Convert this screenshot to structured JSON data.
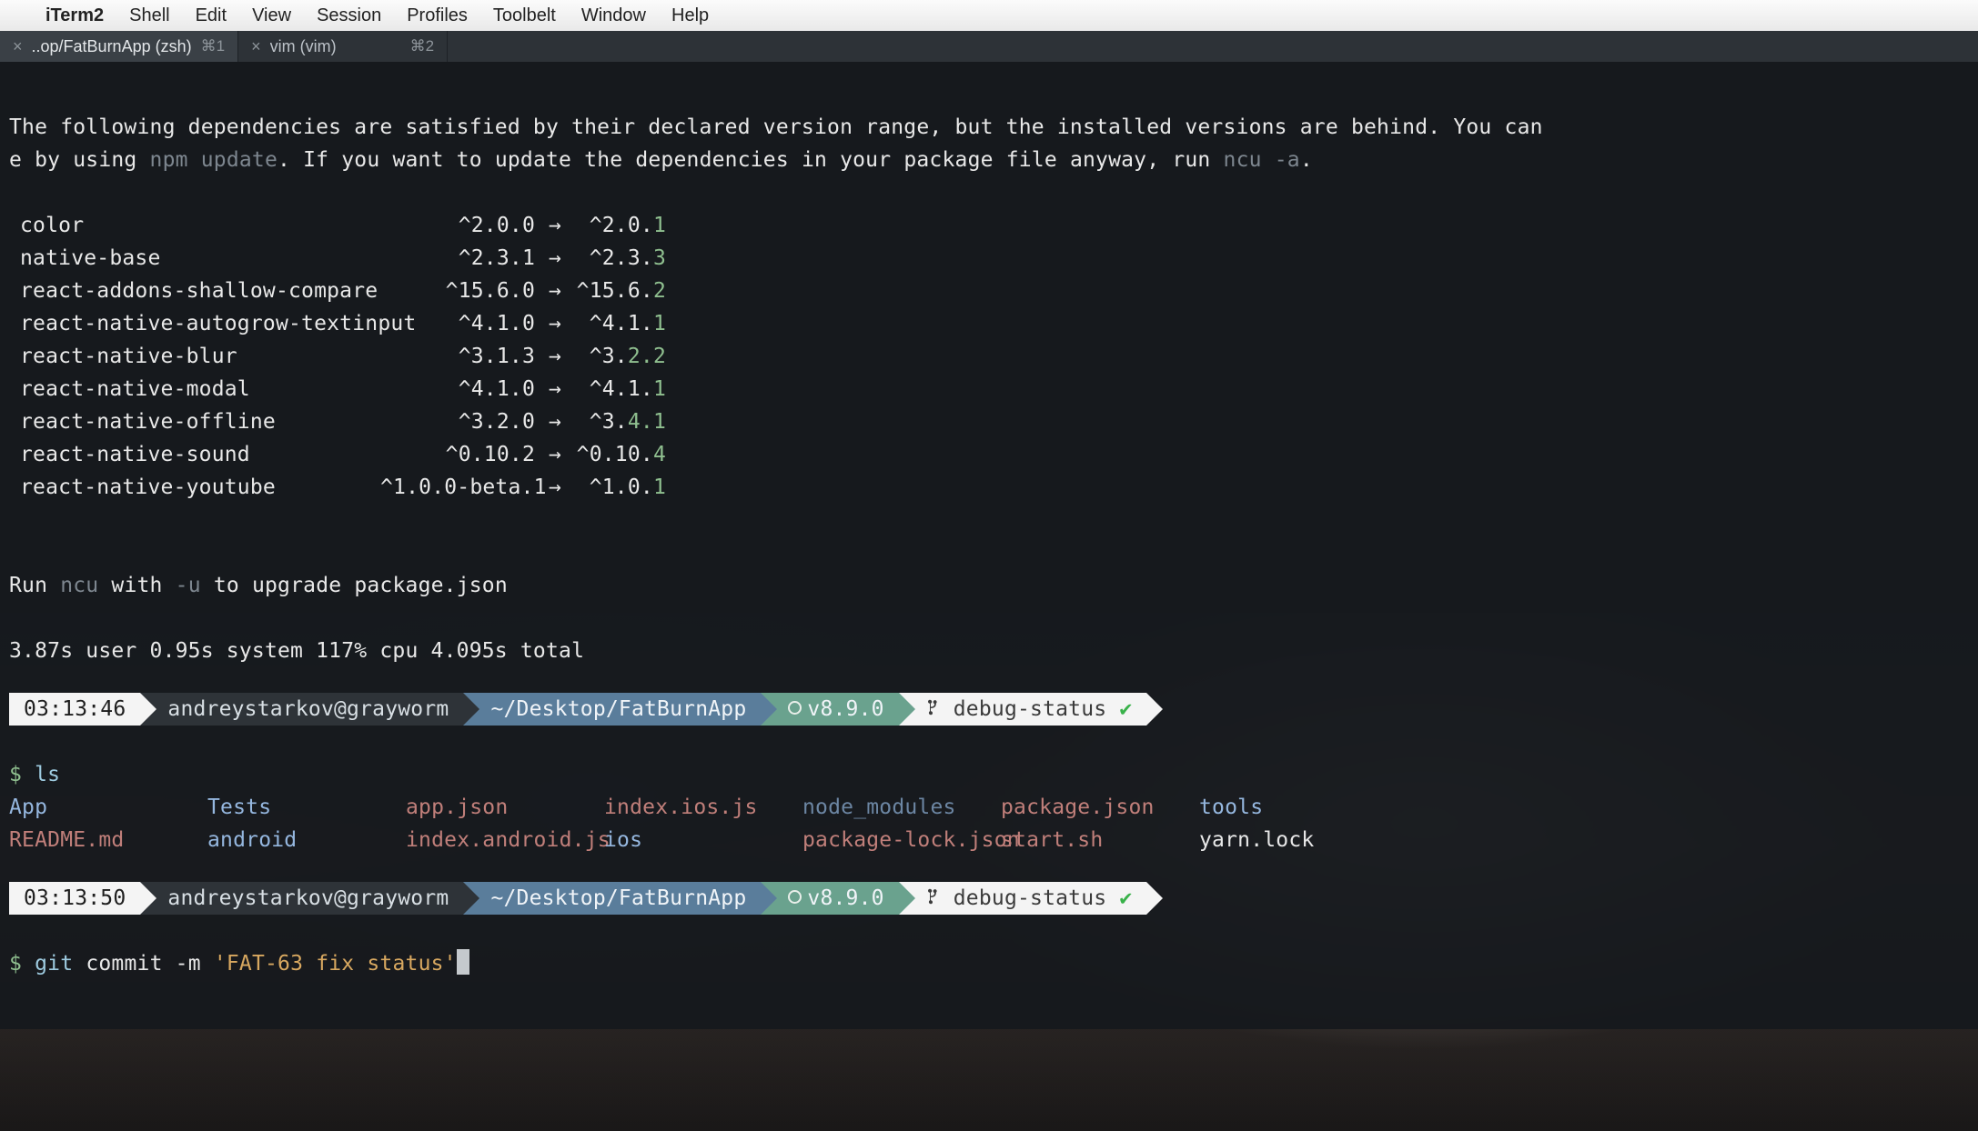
{
  "menubar": {
    "apple": "",
    "app": "iTerm2",
    "items": [
      "Shell",
      "Edit",
      "View",
      "Session",
      "Profiles",
      "Toolbelt",
      "Window",
      "Help"
    ]
  },
  "tabs": [
    {
      "title": "..op/FatBurnApp (zsh)",
      "shortcut": "⌘1",
      "active": true
    },
    {
      "title": "vim (vim)",
      "shortcut": "⌘2",
      "active": false
    }
  ],
  "ncu": {
    "msg_line1": "The following dependencies are satisfied by their declared version range, but the installed versions are behind. You can ",
    "msg_line2a": "e by using ",
    "msg_line2_cmd1": "npm update",
    "msg_line2b": ". If you want to update the dependencies in your package file anyway, run ",
    "msg_line2_cmd2": "ncu -a",
    "msg_line2c": ".",
    "deps": [
      {
        "name": "color",
        "from": "^2.0.0",
        "to_pref": "^2.0.",
        "to_tail": "1"
      },
      {
        "name": "native-base",
        "from": "^2.3.1",
        "to_pref": "^2.3.",
        "to_tail": "3"
      },
      {
        "name": "react-addons-shallow-compare",
        "from": "^15.6.0",
        "to_pref": "^15.6.",
        "to_tail": "2"
      },
      {
        "name": "react-native-autogrow-textinput",
        "from": "^4.1.0",
        "to_pref": "^4.1.",
        "to_tail": "1"
      },
      {
        "name": "react-native-blur",
        "from": "^3.1.3",
        "to_pref": "^3.",
        "to_tail": "2.2"
      },
      {
        "name": "react-native-modal",
        "from": "^4.1.0",
        "to_pref": "^4.1.",
        "to_tail": "1"
      },
      {
        "name": "react-native-offline",
        "from": "^3.2.0",
        "to_pref": "^3.",
        "to_tail": "4.1"
      },
      {
        "name": "react-native-sound",
        "from": "^0.10.2",
        "to_pref": "^0.10.",
        "to_tail": "4"
      },
      {
        "name": "react-native-youtube",
        "from": "^1.0.0-beta.1",
        "to_pref": "^1.0.",
        "to_tail": "1"
      }
    ],
    "arrow": "→",
    "run_a": "Run ",
    "run_ncu": "ncu",
    "run_b": " with ",
    "run_u": "-u",
    "run_c": " to upgrade package.json",
    "timing": "3.87s user 0.95s system 117% cpu 4.095s total"
  },
  "prompt1": {
    "time": "03:13:46",
    "userhost": "andreystarkov@grayworm",
    "path": "~/Desktop/FatBurnApp",
    "node": "v8.9.0",
    "branch": "debug-status",
    "check": "✔",
    "dollar": "$",
    "cmd": "ls"
  },
  "ls": {
    "rows": [
      {
        "c0": {
          "t": "App",
          "cls": "c-blue"
        },
        "c1": {
          "t": "Tests",
          "cls": "c-blue"
        },
        "c2": {
          "t": "app.json",
          "cls": "c-salmon"
        },
        "c3": {
          "t": "index.ios.js",
          "cls": "c-salmon"
        },
        "c4": {
          "t": "node_modules",
          "cls": "c-dimblue"
        },
        "c5": {
          "t": "package.json",
          "cls": "c-salmon"
        },
        "c6": {
          "t": "tools",
          "cls": "c-blue"
        }
      },
      {
        "c0": {
          "t": "README.md",
          "cls": "c-salmon"
        },
        "c1": {
          "t": "android",
          "cls": "c-blue"
        },
        "c2": {
          "t": "index.android.js",
          "cls": "c-salmon"
        },
        "c3": {
          "t": "ios",
          "cls": "c-blue"
        },
        "c4": {
          "t": "package-lock.json",
          "cls": "c-salmon"
        },
        "c5": {
          "t": "start.sh",
          "cls": "c-salmon"
        },
        "c6": {
          "t": "yarn.lock",
          "cls": "c-plain"
        }
      }
    ]
  },
  "prompt2": {
    "time": "03:13:50",
    "userhost": "andreystarkov@grayworm",
    "path": "~/Desktop/FatBurnApp",
    "node": "v8.9.0",
    "branch": "debug-status",
    "check": "✔",
    "dollar": "$",
    "cmd_git": "git",
    "cmd_args": " commit -m ",
    "cmd_str": "'FAT-63 fix status'"
  }
}
